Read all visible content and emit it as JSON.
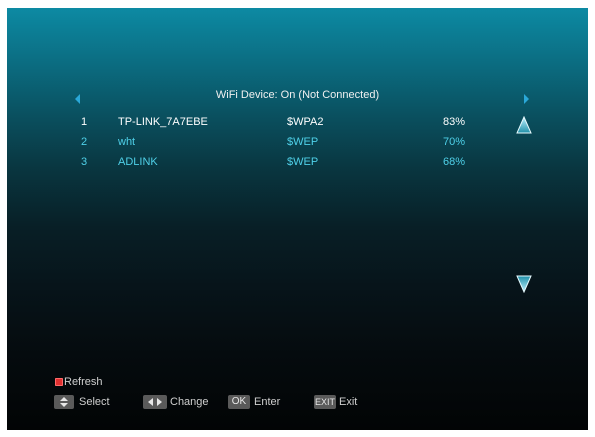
{
  "header": {
    "title": "WiFi Device: On (Not Connected)"
  },
  "networks": [
    {
      "num": "1",
      "ssid": "TP-LINK_7A7EBE",
      "security": "$WPA2",
      "signal": "83%",
      "color": "#ffffff"
    },
    {
      "num": "2",
      "ssid": "wht",
      "security": "$WEP",
      "signal": "70%",
      "color": "#4fd0e8"
    },
    {
      "num": "3",
      "ssid": "ADLINK",
      "security": "$WEP",
      "signal": "68%",
      "color": "#4fd0e8"
    }
  ],
  "footer": {
    "refresh_label": "Refresh",
    "select_label": "Select",
    "change_label": "Change",
    "ok_key": "OK",
    "enter_label": "Enter",
    "exit_key": "EXIT",
    "exit_label": "Exit"
  },
  "icons": {
    "nav_left": "left-triangle-icon",
    "nav_right": "right-triangle-icon",
    "scroll_up": "up-arrow-icon",
    "scroll_down": "down-arrow-icon",
    "red_key": "red-key-icon",
    "updown_key": "up-down-key-icon",
    "leftright_key": "left-right-key-icon"
  },
  "colors": {
    "accent": "#4fd0e8",
    "selected_text": "#ffffff",
    "key_bg": "#5a5a5a",
    "red_key": "#e03030"
  }
}
